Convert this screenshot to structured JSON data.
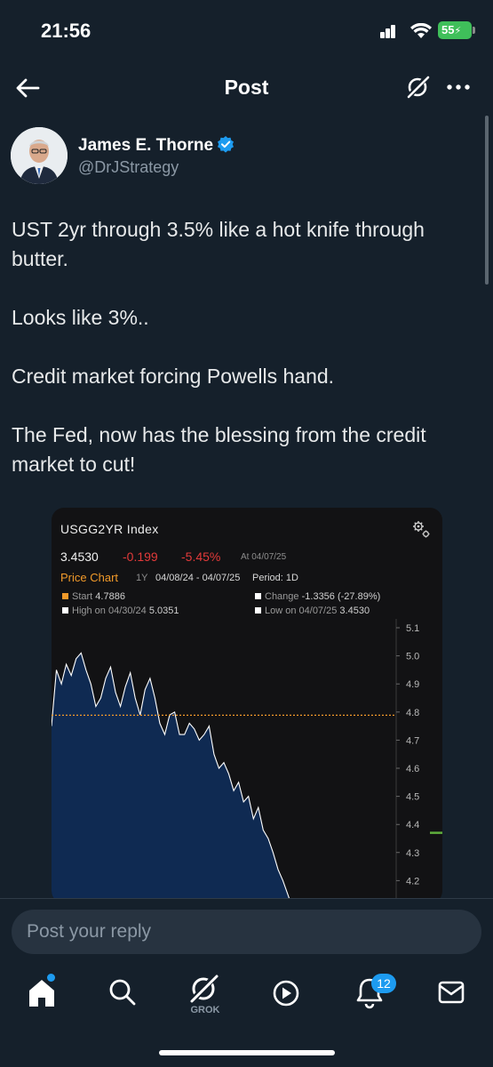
{
  "status_bar": {
    "time": "21:56",
    "battery": "55"
  },
  "header": {
    "title": "Post"
  },
  "author": {
    "name": "James E. Thorne",
    "handle": "@DrJStrategy"
  },
  "post": {
    "paragraphs": [
      "UST 2yr through 3.5% like a hot knife through butter.",
      "Looks like 3%..",
      "Credit market forcing Powells hand.",
      "The Fed, now has the blessing from the credit market to cut!"
    ]
  },
  "chart_card": {
    "ticker": "USGG2YR  Index",
    "last": "3.4530",
    "net_change": "-0.199",
    "pct_change": "-5.45%",
    "as_of": "At 04/07/25",
    "chart_label": "Price Chart",
    "span": "1Y",
    "date_range": "04/08/24 - 04/07/25",
    "period": "Period: 1D",
    "start_label": "Start",
    "start_value": "4.7886",
    "high_label": "High on 04/30/24",
    "high_value": "5.0351",
    "change_label": "Change",
    "change_value": "-1.3356 (-27.89%)",
    "low_label": "Low on 04/07/25",
    "low_value": "3.4530",
    "colors": {
      "start_line": "#f19a2a",
      "resistance_line": "#5fae3c",
      "area_fill": "#0f2a52",
      "area_stroke": "#ffffff"
    }
  },
  "chart_data": {
    "type": "area",
    "title": "USGG2YR  Index",
    "y_ticks": [
      "5.1",
      "5.0",
      "4.9",
      "4.8",
      "4.7",
      "4.6",
      "4.5",
      "4.4",
      "4.3",
      "4.2"
    ],
    "ylim": [
      4.13,
      5.13
    ],
    "x_count": 140,
    "reference_lines": [
      {
        "name": "Start",
        "value": 4.7886,
        "style": "dotted",
        "color": "#f19a2a"
      },
      {
        "name": "",
        "value": 4.37,
        "style": "solid",
        "color": "#5fae3c"
      }
    ],
    "segments": [
      {
        "x": [
          0,
          2,
          4,
          6,
          8,
          10,
          12,
          14,
          16,
          18,
          20,
          22,
          24,
          26,
          28,
          30,
          32,
          34,
          36,
          38,
          40,
          42,
          44,
          46,
          48,
          50,
          52,
          54,
          56,
          58,
          60,
          62,
          64,
          66,
          68,
          70,
          72,
          74,
          76,
          78,
          80,
          82,
          84,
          86,
          88,
          90,
          92,
          94,
          96,
          98,
          100,
          102,
          104,
          106,
          108,
          110,
          112,
          114,
          116,
          118,
          120,
          122,
          124,
          126,
          128,
          130,
          132,
          134
        ],
        "values": [
          4.75,
          4.95,
          4.9,
          4.97,
          4.93,
          4.99,
          5.01,
          4.95,
          4.9,
          4.82,
          4.85,
          4.92,
          4.96,
          4.87,
          4.82,
          4.89,
          4.94,
          4.85,
          4.79,
          4.88,
          4.92,
          4.85,
          4.76,
          4.72,
          4.79,
          4.8,
          4.72,
          4.72,
          4.76,
          4.74,
          4.7,
          4.72,
          4.75,
          4.65,
          4.6,
          4.62,
          4.58,
          4.52,
          4.55,
          4.48,
          4.5,
          4.42,
          4.46,
          4.38,
          4.35,
          4.3,
          4.24,
          4.2,
          4.15,
          4.1,
          4.05,
          4.0,
          3.95,
          3.9,
          3.85,
          3.8,
          3.75,
          3.7,
          3.65,
          3.6,
          3.58,
          3.55,
          3.52,
          3.5,
          3.48,
          3.47,
          3.46,
          3.45
        ]
      },
      {
        "x": [
          215,
          217,
          219,
          221,
          223,
          225,
          227,
          229,
          231,
          233,
          235,
          237,
          239,
          241,
          243,
          245,
          247,
          249,
          251,
          253,
          255,
          257,
          259,
          261,
          263,
          265,
          267,
          269,
          271,
          273,
          275,
          277,
          279,
          281,
          283,
          285,
          287,
          289,
          291,
          293,
          295,
          297,
          299,
          301,
          303,
          305,
          307,
          309,
          311,
          313,
          315,
          317,
          319,
          321,
          323,
          325,
          327,
          329,
          331,
          333,
          335,
          337,
          339
        ],
        "values": [
          4.17,
          4.2,
          4.24,
          4.28,
          4.3,
          4.33,
          4.28,
          4.35,
          4.3,
          4.38,
          4.28,
          4.32,
          4.26,
          4.2,
          4.15,
          4.12,
          4.1,
          4.12,
          4.15,
          4.14,
          4.18,
          4.24,
          4.29,
          4.34,
          4.31,
          4.36,
          4.3,
          4.38,
          4.33,
          4.3,
          4.35,
          4.28,
          4.33,
          4.29,
          4.39,
          4.33,
          4.28,
          4.25,
          4.3,
          4.27,
          4.32,
          4.28,
          4.25,
          4.23,
          4.2,
          4.25,
          4.29,
          4.32,
          4.37,
          4.3,
          4.26,
          4.28,
          4.33,
          4.29,
          4.25,
          4.22,
          4.2,
          4.17,
          4.15,
          4.13,
          4.1,
          4.08,
          4.05
        ]
      }
    ]
  },
  "reply": {
    "placeholder": "Post your reply"
  },
  "tabs": {
    "grok_label": "GROK",
    "notification_count": "12"
  }
}
